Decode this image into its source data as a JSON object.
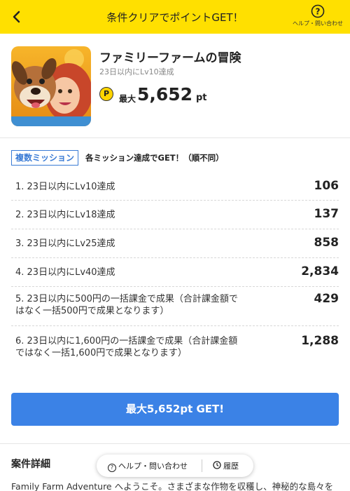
{
  "header": {
    "title": "条件クリアでポイントGET！",
    "back_icon": "chevron-left-icon",
    "help_icon": "question-circle-icon",
    "help_label": "ヘルプ・問い合わせ",
    "background": "#ffe000"
  },
  "app": {
    "name": "ファミリーファームの冒険",
    "condition": "23日以内にLv10達成",
    "points_coin": "P",
    "points_prefix": "最大",
    "points_value": "5,652",
    "points_unit": "pt"
  },
  "missions": {
    "badge": "複数ミッション",
    "note": "各ミッション達成でGET！（順不同）",
    "items": [
      {
        "text": "1. 23日以内にLv10達成",
        "points": "106"
      },
      {
        "text": "2. 23日以内にLv18達成",
        "points": "137"
      },
      {
        "text": "3. 23日以内にLv25達成",
        "points": "858"
      },
      {
        "text": "4. 23日以内にLv40達成",
        "points": "2,834"
      },
      {
        "text": "5. 23日以内に500円の一括課金で成果（合計課金額ではなく一括500円で成果となります）",
        "points": "429"
      },
      {
        "text": "6. 23日以内に1,600円の一括課金で成果（合計課金額ではなく一括1,600円で成果となります）",
        "points": "1,288"
      }
    ]
  },
  "cta": {
    "label": "最大5,652pt GET!",
    "color": "#3b82e6"
  },
  "details": {
    "heading": "案件詳細",
    "body": "Family Farm Adventure へようこそ。さまざまな作物を収穫し、神秘的な島々を"
  },
  "floating_bar": {
    "help_label": "ヘルプ・問い合わせ",
    "history_label": "履歴"
  }
}
